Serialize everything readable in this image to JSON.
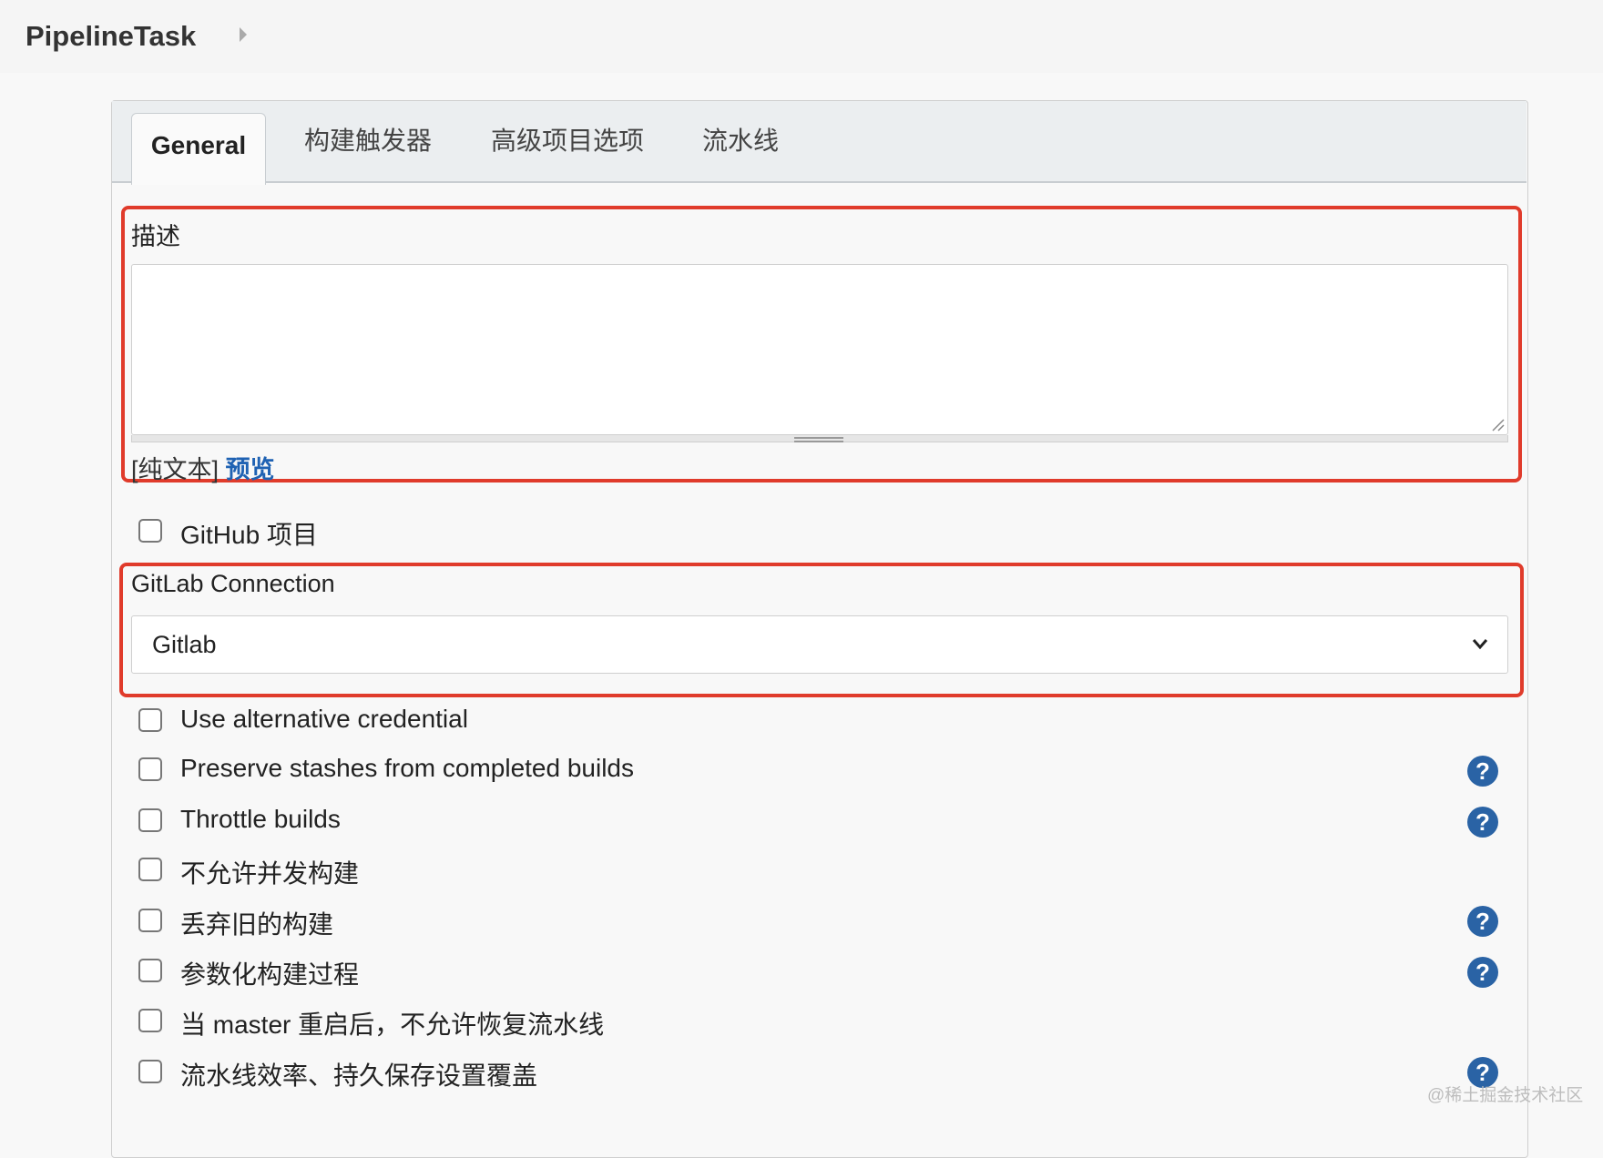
{
  "breadcrumb": {
    "title": "PipelineTask"
  },
  "tabs": [
    {
      "label": "General",
      "active": true
    },
    {
      "label": "构建触发器"
    },
    {
      "label": "高级项目选项"
    },
    {
      "label": "流水线"
    }
  ],
  "description": {
    "label": "描述",
    "value": "",
    "format_label": "[纯文本]",
    "preview_link": "预览"
  },
  "github_project": {
    "label": "GitHub 项目",
    "checked": false
  },
  "gitlab_connection": {
    "label": "GitLab Connection",
    "selected": "Gitlab"
  },
  "options": [
    {
      "label": "Use alternative credential",
      "checked": false,
      "help": false
    },
    {
      "label": "Preserve stashes from completed builds",
      "checked": false,
      "help": true
    },
    {
      "label": "Throttle builds",
      "checked": false,
      "help": true
    },
    {
      "label": "不允许并发构建",
      "checked": false,
      "help": false
    },
    {
      "label": "丢弃旧的构建",
      "checked": false,
      "help": true
    },
    {
      "label": "参数化构建过程",
      "checked": false,
      "help": true
    },
    {
      "label": "当 master 重启后，不允许恢复流水线",
      "checked": false,
      "help": false
    },
    {
      "label": "流水线效率、持久保存设置覆盖",
      "checked": false,
      "help": true
    }
  ],
  "help_glyph": "?",
  "watermark": "@稀土掘金技术社区",
  "colors": {
    "highlight": "#e03b2b",
    "link": "#1f62b3",
    "help_badge": "#2a63a5"
  }
}
